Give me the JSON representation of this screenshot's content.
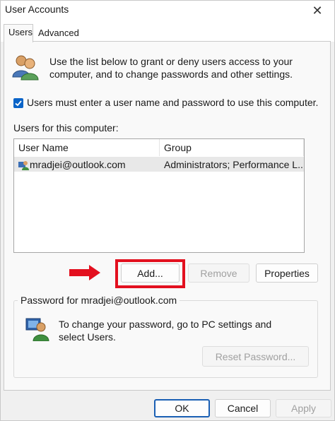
{
  "window": {
    "title": "User Accounts",
    "close_glyph": "✕"
  },
  "tabs": [
    {
      "label": "Users",
      "active": true
    },
    {
      "label": "Advanced",
      "active": false
    }
  ],
  "intro": {
    "icon": "users-group-icon",
    "text": "Use the list below to grant or deny users access to your computer, and to change passwords and other settings."
  },
  "require_login": {
    "checked": true,
    "label": "Users must enter a user name and password to use this computer."
  },
  "users_list": {
    "caption": "Users for this computer:",
    "columns": [
      "User Name",
      "Group"
    ],
    "rows": [
      {
        "user_name": "mradjei@outlook.com",
        "group": "Administrators; Performance L...",
        "icon": "user-account-icon"
      }
    ]
  },
  "list_buttons": {
    "add": "Add...",
    "remove": "Remove",
    "properties": "Properties"
  },
  "annotation": {
    "arrow_color": "#e3101f",
    "highlight_color": "#e3101f"
  },
  "password_group": {
    "title": "Password for mradjei@outlook.com",
    "icon": "password-user-icon",
    "text": "To change your password, go to PC settings and select Users.",
    "reset_button": "Reset Password..."
  },
  "footer": {
    "ok": "OK",
    "cancel": "Cancel",
    "apply": "Apply"
  },
  "colors": {
    "accent": "#0a64c8",
    "selected_row": "#e8e8e8"
  }
}
